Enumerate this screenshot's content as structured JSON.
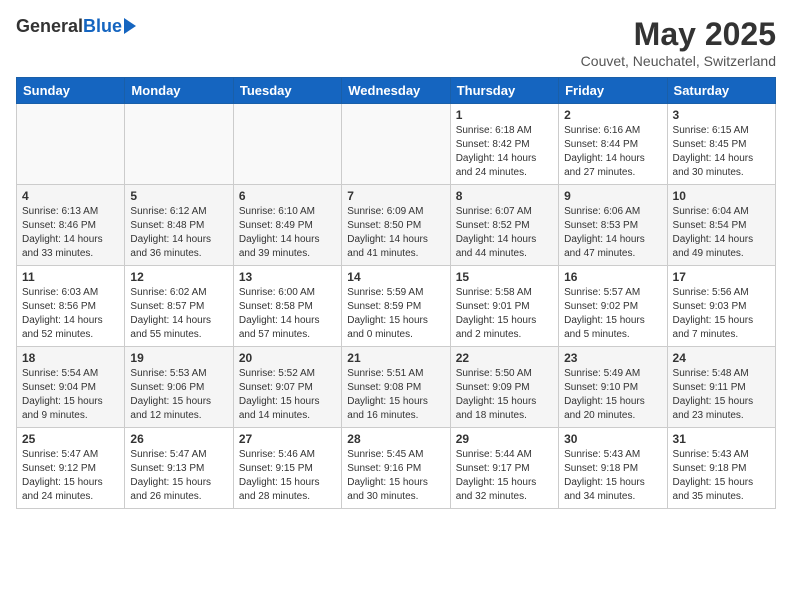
{
  "header": {
    "logo_general": "General",
    "logo_blue": "Blue",
    "title": "May 2025",
    "location": "Couvet, Neuchatel, Switzerland"
  },
  "weekdays": [
    "Sunday",
    "Monday",
    "Tuesday",
    "Wednesday",
    "Thursday",
    "Friday",
    "Saturday"
  ],
  "weeks": [
    [
      {
        "day": "",
        "info": ""
      },
      {
        "day": "",
        "info": ""
      },
      {
        "day": "",
        "info": ""
      },
      {
        "day": "",
        "info": ""
      },
      {
        "day": "1",
        "info": "Sunrise: 6:18 AM\nSunset: 8:42 PM\nDaylight: 14 hours\nand 24 minutes."
      },
      {
        "day": "2",
        "info": "Sunrise: 6:16 AM\nSunset: 8:44 PM\nDaylight: 14 hours\nand 27 minutes."
      },
      {
        "day": "3",
        "info": "Sunrise: 6:15 AM\nSunset: 8:45 PM\nDaylight: 14 hours\nand 30 minutes."
      }
    ],
    [
      {
        "day": "4",
        "info": "Sunrise: 6:13 AM\nSunset: 8:46 PM\nDaylight: 14 hours\nand 33 minutes."
      },
      {
        "day": "5",
        "info": "Sunrise: 6:12 AM\nSunset: 8:48 PM\nDaylight: 14 hours\nand 36 minutes."
      },
      {
        "day": "6",
        "info": "Sunrise: 6:10 AM\nSunset: 8:49 PM\nDaylight: 14 hours\nand 39 minutes."
      },
      {
        "day": "7",
        "info": "Sunrise: 6:09 AM\nSunset: 8:50 PM\nDaylight: 14 hours\nand 41 minutes."
      },
      {
        "day": "8",
        "info": "Sunrise: 6:07 AM\nSunset: 8:52 PM\nDaylight: 14 hours\nand 44 minutes."
      },
      {
        "day": "9",
        "info": "Sunrise: 6:06 AM\nSunset: 8:53 PM\nDaylight: 14 hours\nand 47 minutes."
      },
      {
        "day": "10",
        "info": "Sunrise: 6:04 AM\nSunset: 8:54 PM\nDaylight: 14 hours\nand 49 minutes."
      }
    ],
    [
      {
        "day": "11",
        "info": "Sunrise: 6:03 AM\nSunset: 8:56 PM\nDaylight: 14 hours\nand 52 minutes."
      },
      {
        "day": "12",
        "info": "Sunrise: 6:02 AM\nSunset: 8:57 PM\nDaylight: 14 hours\nand 55 minutes."
      },
      {
        "day": "13",
        "info": "Sunrise: 6:00 AM\nSunset: 8:58 PM\nDaylight: 14 hours\nand 57 minutes."
      },
      {
        "day": "14",
        "info": "Sunrise: 5:59 AM\nSunset: 8:59 PM\nDaylight: 15 hours\nand 0 minutes."
      },
      {
        "day": "15",
        "info": "Sunrise: 5:58 AM\nSunset: 9:01 PM\nDaylight: 15 hours\nand 2 minutes."
      },
      {
        "day": "16",
        "info": "Sunrise: 5:57 AM\nSunset: 9:02 PM\nDaylight: 15 hours\nand 5 minutes."
      },
      {
        "day": "17",
        "info": "Sunrise: 5:56 AM\nSunset: 9:03 PM\nDaylight: 15 hours\nand 7 minutes."
      }
    ],
    [
      {
        "day": "18",
        "info": "Sunrise: 5:54 AM\nSunset: 9:04 PM\nDaylight: 15 hours\nand 9 minutes."
      },
      {
        "day": "19",
        "info": "Sunrise: 5:53 AM\nSunset: 9:06 PM\nDaylight: 15 hours\nand 12 minutes."
      },
      {
        "day": "20",
        "info": "Sunrise: 5:52 AM\nSunset: 9:07 PM\nDaylight: 15 hours\nand 14 minutes."
      },
      {
        "day": "21",
        "info": "Sunrise: 5:51 AM\nSunset: 9:08 PM\nDaylight: 15 hours\nand 16 minutes."
      },
      {
        "day": "22",
        "info": "Sunrise: 5:50 AM\nSunset: 9:09 PM\nDaylight: 15 hours\nand 18 minutes."
      },
      {
        "day": "23",
        "info": "Sunrise: 5:49 AM\nSunset: 9:10 PM\nDaylight: 15 hours\nand 20 minutes."
      },
      {
        "day": "24",
        "info": "Sunrise: 5:48 AM\nSunset: 9:11 PM\nDaylight: 15 hours\nand 23 minutes."
      }
    ],
    [
      {
        "day": "25",
        "info": "Sunrise: 5:47 AM\nSunset: 9:12 PM\nDaylight: 15 hours\nand 24 minutes."
      },
      {
        "day": "26",
        "info": "Sunrise: 5:47 AM\nSunset: 9:13 PM\nDaylight: 15 hours\nand 26 minutes."
      },
      {
        "day": "27",
        "info": "Sunrise: 5:46 AM\nSunset: 9:15 PM\nDaylight: 15 hours\nand 28 minutes."
      },
      {
        "day": "28",
        "info": "Sunrise: 5:45 AM\nSunset: 9:16 PM\nDaylight: 15 hours\nand 30 minutes."
      },
      {
        "day": "29",
        "info": "Sunrise: 5:44 AM\nSunset: 9:17 PM\nDaylight: 15 hours\nand 32 minutes."
      },
      {
        "day": "30",
        "info": "Sunrise: 5:43 AM\nSunset: 9:18 PM\nDaylight: 15 hours\nand 34 minutes."
      },
      {
        "day": "31",
        "info": "Sunrise: 5:43 AM\nSunset: 9:18 PM\nDaylight: 15 hours\nand 35 minutes."
      }
    ]
  ]
}
